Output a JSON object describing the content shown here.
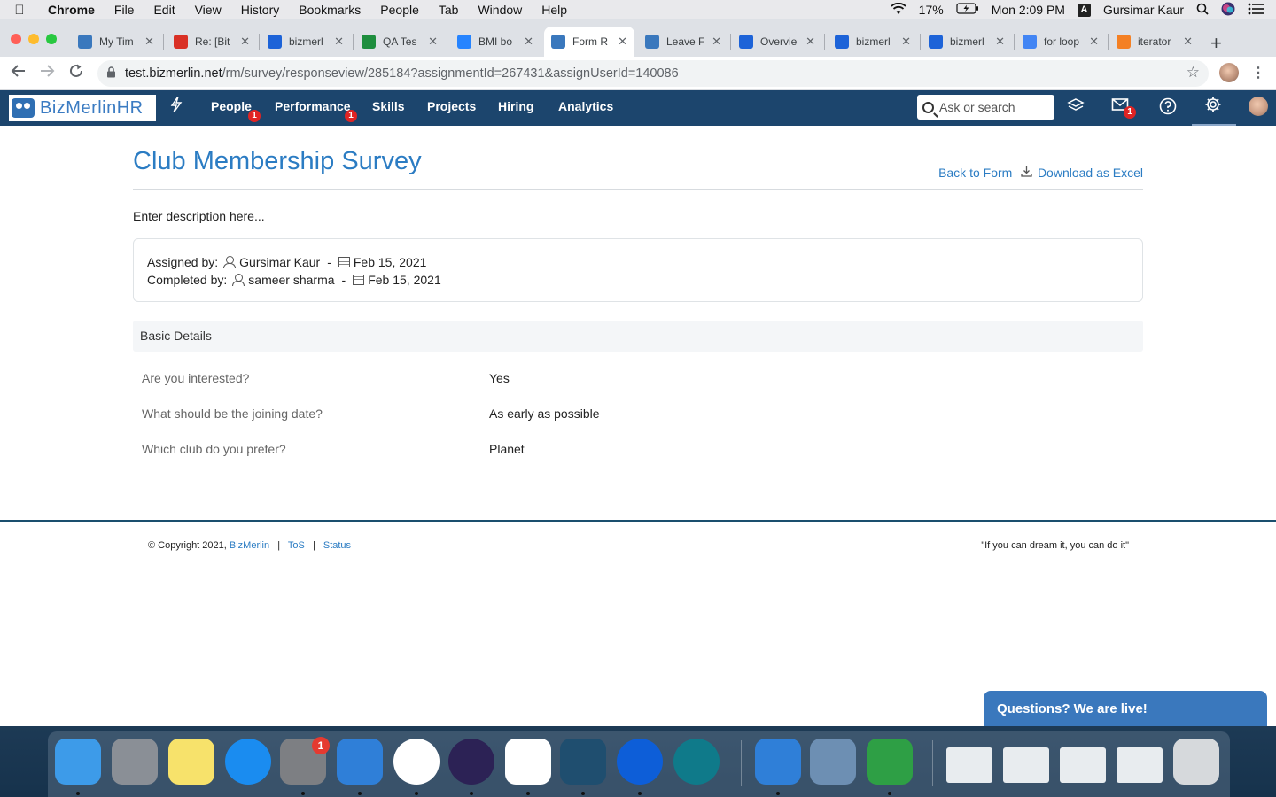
{
  "os_menubar": {
    "app_name": "Chrome",
    "menus": [
      "File",
      "Edit",
      "View",
      "History",
      "Bookmarks",
      "People",
      "Tab",
      "Window",
      "Help"
    ],
    "battery": "17%",
    "clock": "Mon 2:09 PM",
    "input_source": "A",
    "user": "Gursimar Kaur"
  },
  "browser": {
    "tabs": [
      {
        "title": "My Tim",
        "icon": "bizmerlin-people-icon",
        "color": "#3a78bd"
      },
      {
        "title": "Re: [Bit",
        "icon": "gmail-icon",
        "color": "#d93025"
      },
      {
        "title": "bizmerl",
        "icon": "bitbucket-icon",
        "color": "#1d63d8"
      },
      {
        "title": "QA Tes",
        "icon": "google-sheets-icon",
        "color": "#1e8e3e"
      },
      {
        "title": "BMI bo",
        "icon": "jira-icon",
        "color": "#2684ff"
      },
      {
        "title": "Form R",
        "icon": "bizmerlin-people-icon",
        "color": "#3a78bd"
      },
      {
        "title": "Leave F",
        "icon": "bizmerlin-people-icon",
        "color": "#3a78bd"
      },
      {
        "title": "Overvie",
        "icon": "bitbucket-icon",
        "color": "#1d63d8"
      },
      {
        "title": "bizmerl",
        "icon": "bitbucket-icon",
        "color": "#1d63d8"
      },
      {
        "title": "bizmerl",
        "icon": "bitbucket-icon",
        "color": "#1d63d8"
      },
      {
        "title": "for loop",
        "icon": "google-icon",
        "color": "#4285f4"
      },
      {
        "title": "iterator",
        "icon": "stackoverflow-icon",
        "color": "#f48024"
      }
    ],
    "active_tab_index": 5,
    "url_host": "test.bizmerlin.net",
    "url_path": "/rm/survey/responseview/285184?assignmentId=267431&assignUserId=140086"
  },
  "app_nav": {
    "logo_text": "BizMerlinHR",
    "items": [
      {
        "label": "People",
        "badge": "1"
      },
      {
        "label": "Performance",
        "badge": "1"
      },
      {
        "label": "Skills",
        "badge": ""
      },
      {
        "label": "Projects",
        "badge": ""
      },
      {
        "label": "Hiring",
        "badge": ""
      },
      {
        "label": "Analytics",
        "badge": ""
      }
    ],
    "search_placeholder": "Ask or search",
    "mail_badge": "1"
  },
  "survey": {
    "title": "Club Membership Survey",
    "back_link": "Back to Form",
    "download_link": "Download as Excel",
    "description": "Enter description here...",
    "assigned_label": "Assigned by:",
    "assigned_by": "Gursimar Kaur",
    "assigned_date": "Feb 15, 2021",
    "completed_label": "Completed by:",
    "completed_by": "sameer sharma",
    "completed_date": "Feb 15, 2021",
    "section_title": "Basic Details",
    "questions": [
      {
        "q": "Are you interested?",
        "a": "Yes"
      },
      {
        "q": "What should be the joining date?",
        "a": "As early as possible"
      },
      {
        "q": "Which club do you prefer?",
        "a": "Planet"
      }
    ]
  },
  "footer": {
    "copyright": "© Copyright 2021,",
    "company_link": "BizMerlin",
    "tos_link": "ToS",
    "status_link": "Status",
    "quote": "\"If you can dream it, you can do it\""
  },
  "chat_widget": {
    "label": "Questions? We are live!"
  },
  "dock": {
    "apps": [
      {
        "name": "finder-icon",
        "color": "#3d9be9"
      },
      {
        "name": "launchpad-icon",
        "color": "#8a8f96"
      },
      {
        "name": "notes-icon",
        "color": "#f7e26b"
      },
      {
        "name": "app-store-icon",
        "color": "#1a8cf0"
      },
      {
        "name": "system-preferences-icon",
        "color": "#7d7f83",
        "badge": "1"
      },
      {
        "name": "xcode-icon",
        "color": "#2f7fd8"
      },
      {
        "name": "chrome-icon",
        "color": "#ffffff"
      },
      {
        "name": "eclipse-icon",
        "color": "#2c2255"
      },
      {
        "name": "slack-icon",
        "color": "#ffffff"
      },
      {
        "name": "mysql-workbench-icon",
        "color": "#1f4e6f"
      },
      {
        "name": "sourcetree-icon",
        "color": "#0d5ed8"
      },
      {
        "name": "webex-icon",
        "color": "#0f7a8a"
      },
      {
        "name": "simulator-icon",
        "color": "#2f7fd8"
      },
      {
        "name": "preview-icon",
        "color": "#6d8fb3"
      },
      {
        "name": "numbers-icon",
        "color": "#2e9f45"
      },
      {
        "name": "window-thumbnail-icon",
        "color": "#e8ecef"
      },
      {
        "name": "window-thumbnail-icon",
        "color": "#e8ecef"
      },
      {
        "name": "window-thumbnail-icon",
        "color": "#e8ecef"
      },
      {
        "name": "window-thumbnail-icon",
        "color": "#e8ecef"
      },
      {
        "name": "trash-icon",
        "color": "#d6d9dc"
      }
    ]
  }
}
